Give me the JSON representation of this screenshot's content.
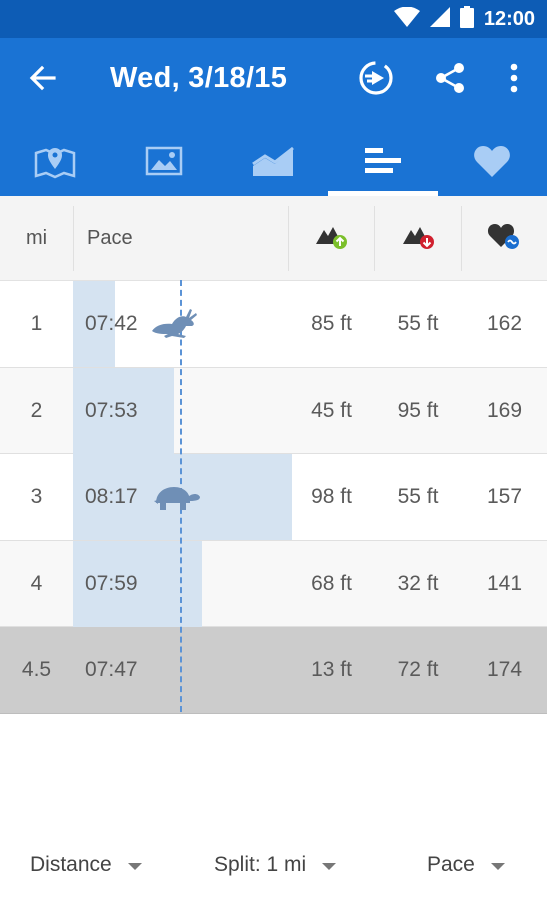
{
  "status_bar": {
    "time": "12:00",
    "icons": [
      "wifi-icon",
      "cell-signal-icon",
      "battery-icon"
    ]
  },
  "app_bar": {
    "title": "Wed, 3/18/15",
    "back_icon": "arrow-left-icon",
    "actions": [
      "replay-icon",
      "share-icon",
      "more-vert-icon"
    ],
    "colors": {
      "status": "#0d5cb5",
      "bar": "#1a73d4"
    }
  },
  "tabs": [
    {
      "icon": "map-icon",
      "active": false
    },
    {
      "icon": "photo-icon",
      "active": false
    },
    {
      "icon": "area-chart-icon",
      "active": false
    },
    {
      "icon": "splits-bars-icon",
      "active": true
    },
    {
      "icon": "heart-icon",
      "active": false
    }
  ],
  "table": {
    "headers": {
      "unit": "mi",
      "pace": "Pace",
      "elev_gain": "elevation-gain-icon",
      "elev_loss": "elevation-loss-icon",
      "heart_rate": "heart-rate-icon"
    },
    "rows": [
      {
        "mi": "1",
        "pace": "07:42",
        "gain": "85 ft",
        "loss": "55 ft",
        "hr": "162",
        "pace_fraction": 0.19,
        "marker": "rabbit-icon"
      },
      {
        "mi": "2",
        "pace": "07:53",
        "gain": "45 ft",
        "loss": "95 ft",
        "hr": "169",
        "pace_fraction": 0.46
      },
      {
        "mi": "3",
        "pace": "08:17",
        "gain": "98 ft",
        "loss": "55 ft",
        "hr": "157",
        "pace_fraction": 1.0,
        "marker": "turtle-icon"
      },
      {
        "mi": "4",
        "pace": "07:59",
        "gain": "68 ft",
        "loss": "32 ft",
        "hr": "141",
        "pace_fraction": 0.59
      }
    ],
    "summary": {
      "mi": "4.5",
      "pace": "07:47",
      "gain": "13 ft",
      "loss": "72 ft",
      "hr": "174"
    },
    "bar_color": "#d5e3f1",
    "avg_line_color": "#5b93d6"
  },
  "controls": {
    "distance": "Distance",
    "split": "Split: 1 mi",
    "metric": "Pace"
  }
}
